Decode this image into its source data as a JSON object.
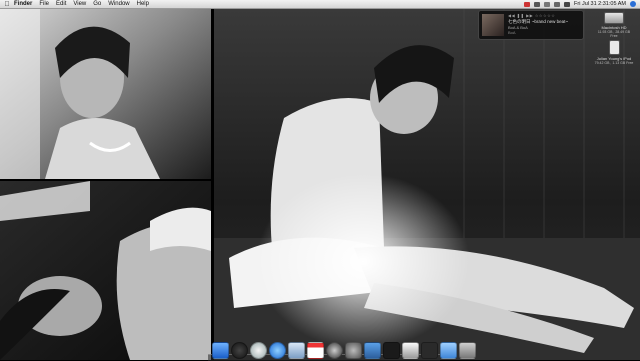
{
  "menubar": {
    "apple": "",
    "items": [
      "Finder",
      "File",
      "Edit",
      "View",
      "Go",
      "Window",
      "Help"
    ],
    "clock": "Fri Jul 31  2:31:05 AM"
  },
  "now_playing": {
    "rating": "☆☆☆☆☆",
    "title": "七色の明日 ~brand new beat~",
    "artist": "BoA & BoA",
    "album": "BoA"
  },
  "desktop_icons": [
    {
      "label": "Macintosh HD",
      "detail": "11.93 GB , 28.49 GB Free"
    },
    {
      "label": "Julian Young's iPod",
      "detail": "79.42 GB  ,  1.13 GB Free"
    }
  ],
  "dock": {
    "icons": [
      "finder-icon",
      "dashboard-icon",
      "itunes-icon",
      "safari-icon",
      "mail-icon",
      "ical-icon",
      "quicktime-icon",
      "system-preferences-icon",
      "preview-icon",
      "terminal-icon",
      "photos-icon",
      "activity-monitor-icon",
      "folder-icon",
      "trash-icon"
    ]
  },
  "colors": {
    "menubar": "#e0e0e0",
    "background": "#000000"
  }
}
